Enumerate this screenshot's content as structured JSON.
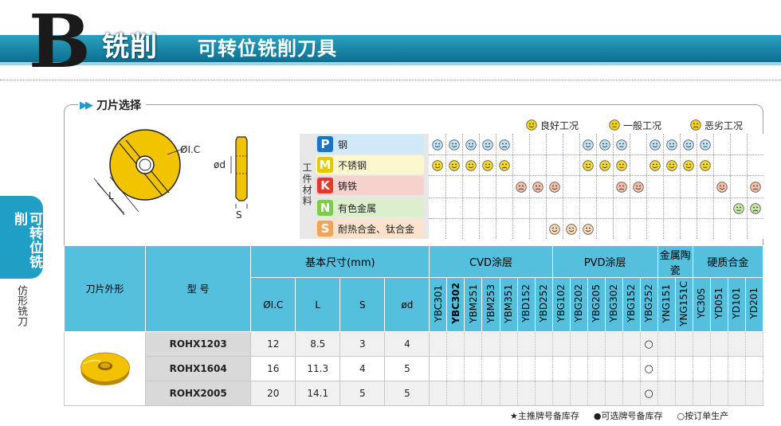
{
  "header": {
    "letter": "B",
    "category": "铣削",
    "title": "可转位铣削刀具"
  },
  "side_tab": {
    "label": "可转位铣削",
    "sub_label": "仿形铣刀"
  },
  "section": {
    "title": "刀片选择"
  },
  "diagram": {
    "label_ic": "ØI.C",
    "label_l": "L",
    "label_d": "ød",
    "label_s": "S"
  },
  "legend": {
    "good": "良好工况",
    "normal": "一般工况",
    "bad": "恶劣工况"
  },
  "material_label": "工件材料",
  "materials": [
    {
      "code": "P",
      "name": "钢",
      "color": "#1a73c9",
      "bg": "#cfe9f8"
    },
    {
      "code": "M",
      "name": "不锈钢",
      "color": "#e9c600",
      "bg": "#fdf7cf"
    },
    {
      "code": "K",
      "name": "铸铁",
      "color": "#e03a2a",
      "bg": "#f7d2cc"
    },
    {
      "code": "N",
      "name": "有色金属",
      "color": "#7ccb4a",
      "bg": "#dcefcd"
    },
    {
      "code": "S",
      "name": "耐热合金、钛合金",
      "color": "#f0a35a",
      "bg": "#fbe2cc"
    }
  ],
  "face_colors": {
    "P": "#bfe4f7",
    "M": "#f5da2b",
    "K": "#f7bfa7",
    "N": "#c6e6a9",
    "S": "#f7d9b3"
  },
  "matrix": {
    "P": [
      1,
      1,
      1,
      1,
      3,
      0,
      0,
      0,
      0,
      1,
      1,
      2,
      0,
      1,
      1,
      1,
      2,
      0,
      0,
      0
    ],
    "M": [
      1,
      1,
      1,
      1,
      3,
      0,
      0,
      0,
      0,
      1,
      1,
      2,
      0,
      1,
      1,
      1,
      2,
      0,
      0,
      0
    ],
    "K": [
      0,
      0,
      0,
      0,
      0,
      3,
      3,
      1,
      0,
      0,
      0,
      3,
      1,
      0,
      0,
      0,
      0,
      1,
      0,
      3
    ],
    "N": [
      0,
      0,
      0,
      0,
      0,
      0,
      0,
      0,
      0,
      0,
      0,
      0,
      0,
      0,
      0,
      0,
      0,
      0,
      2,
      3
    ],
    "S": [
      0,
      0,
      0,
      0,
      0,
      0,
      0,
      1,
      1,
      1,
      0,
      0,
      0,
      0,
      0,
      0,
      0,
      0,
      0,
      0
    ]
  },
  "table": {
    "shape_header": "刀片外形",
    "model_header": "型 号",
    "dim_header": "基本尺寸(mm)",
    "dim_cols": [
      "ØI.C",
      "L",
      "S",
      "ød"
    ],
    "groups": [
      {
        "name": "CVD涂层",
        "codes": [
          "YBC301",
          "YBC302",
          "YBM251",
          "YBM253",
          "YBM351",
          "YBD152",
          "YBD252"
        ],
        "bold": [
          1
        ]
      },
      {
        "name": "PVD涂层",
        "codes": [
          "YBG102",
          "YBG202",
          "YBG205",
          "YBG302",
          "YBG152",
          "YBG252"
        ],
        "bold": []
      },
      {
        "name": "金属陶瓷",
        "codes": [
          "YNG151",
          "YNG151C"
        ],
        "bold": []
      },
      {
        "name": "硬质合金",
        "codes": [
          "YC30S",
          "YD051",
          "YD101",
          "YD201"
        ],
        "bold": []
      }
    ],
    "rows": [
      {
        "model": "ROHX1203",
        "dims": [
          "12",
          "8.5",
          "3",
          "4"
        ],
        "marks": {
          "12": "○"
        }
      },
      {
        "model": "ROHX1604",
        "dims": [
          "16",
          "11.3",
          "4",
          "5"
        ],
        "marks": {
          "12": "○"
        }
      },
      {
        "model": "ROHX2005",
        "dims": [
          "20",
          "14.1",
          "5",
          "5"
        ],
        "marks": {
          "12": "○"
        }
      }
    ]
  },
  "footer": {
    "star": "★主推牌号备库存",
    "dot": "●可选牌号备库存",
    "circle": "○按订单生产"
  }
}
